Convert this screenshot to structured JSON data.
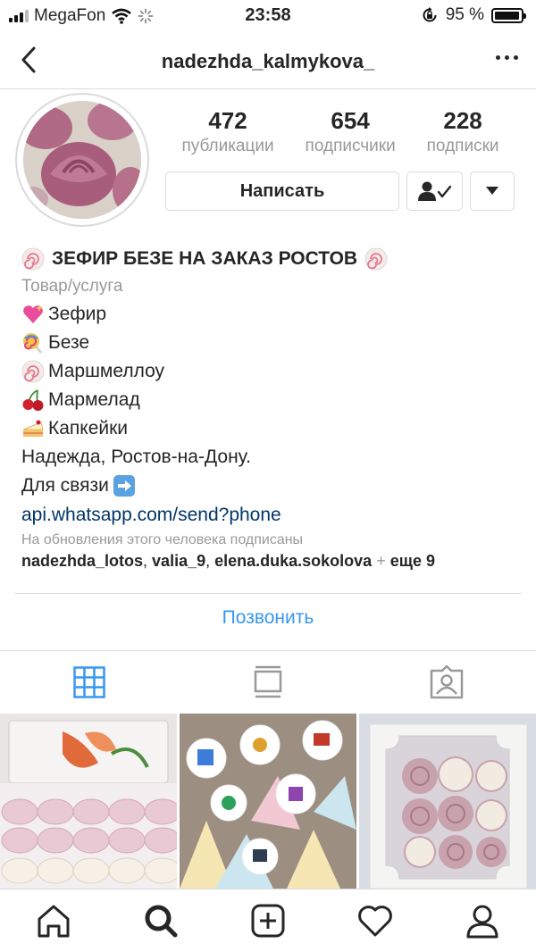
{
  "status_bar": {
    "carrier": "MegaFon",
    "time": "23:58",
    "battery": "95 %",
    "battery_level": 0.95
  },
  "header": {
    "username": "nadezhda_kalmykova_"
  },
  "stats": [
    {
      "value": "472",
      "label": "публикации"
    },
    {
      "value": "654",
      "label": "подписчики"
    },
    {
      "value": "228",
      "label": "подписки"
    }
  ],
  "actions": {
    "message_label": "Написать"
  },
  "bio": {
    "name": "ЗЕФИР БЕЗЕ НА ЗАКАЗ РОСТОВ",
    "category": "Товар/услуга",
    "lines": [
      "Зефир",
      "Безе",
      "Маршмеллоу",
      "Мармелад",
      "Капкейки",
      "Надежда, Ростов-на-Дону.",
      "Для связи"
    ],
    "link": "api.whatsapp.com/send?phone"
  },
  "followed_by": {
    "caption": "На обновления этого человека подписаны",
    "users": [
      "nadezhda_lotos",
      "valia_9",
      "elena.duka.sokolova"
    ],
    "more": "еще 9"
  },
  "call_button": "Позвонить",
  "colors": {
    "link": "#003569",
    "accent": "#3897f0",
    "muted": "#999999",
    "border": "#dbdbdb"
  },
  "icons": {
    "tabs": [
      "grid-icon",
      "feed-icon",
      "tagged-icon"
    ],
    "bottom_nav": [
      "home-icon",
      "search-icon",
      "add-icon",
      "heart-icon",
      "profile-icon"
    ]
  }
}
